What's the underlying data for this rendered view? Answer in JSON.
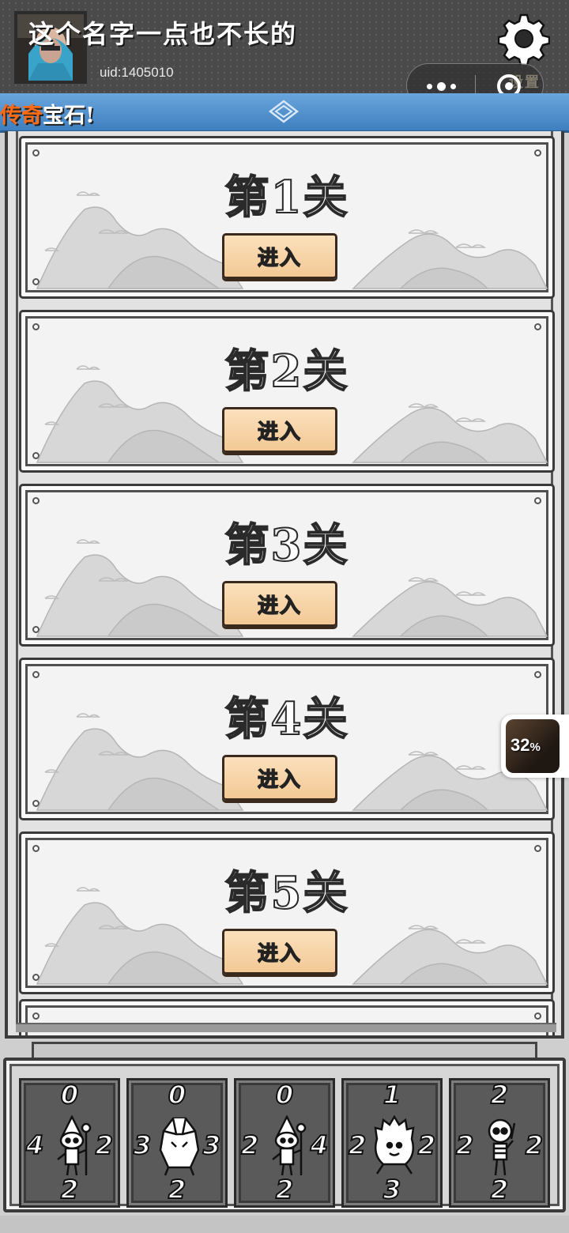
{
  "header": {
    "player_name": "这个名字一点也不长的",
    "uid": "uid:1405010",
    "settings_label": "设置",
    "avatar_icon": "player-avatar"
  },
  "marquee": {
    "highlight": "传奇",
    "rest": "宝石!"
  },
  "levels": [
    {
      "title": "第1关",
      "button": "进入"
    },
    {
      "title": "第2关",
      "button": "进入"
    },
    {
      "title": "第3关",
      "button": "进入"
    },
    {
      "title": "第4关",
      "button": "进入"
    },
    {
      "title": "第5关",
      "button": "进入"
    }
  ],
  "progress_badge": {
    "value": "32",
    "unit": "%"
  },
  "hand": [
    {
      "top": "0",
      "left": "4",
      "right": "2",
      "bottom": "2",
      "creature": "wizard-icon"
    },
    {
      "top": "0",
      "left": "3",
      "right": "3",
      "bottom": "2",
      "creature": "crystal-golem-icon"
    },
    {
      "top": "0",
      "left": "2",
      "right": "4",
      "bottom": "2",
      "creature": "wizard-icon"
    },
    {
      "top": "1",
      "left": "2",
      "right": "2",
      "bottom": "3",
      "creature": "flame-spirit-icon"
    },
    {
      "top": "2",
      "left": "2",
      "right": "2",
      "bottom": "2",
      "creature": "skeleton-icon"
    }
  ],
  "colors": {
    "header_bg": "#4a4a4a",
    "marquee_bg": "#4f8fcf",
    "marquee_highlight": "#ff6a14",
    "button_bg": "#f6d3a6",
    "card_bg": "#5a5a5a"
  }
}
